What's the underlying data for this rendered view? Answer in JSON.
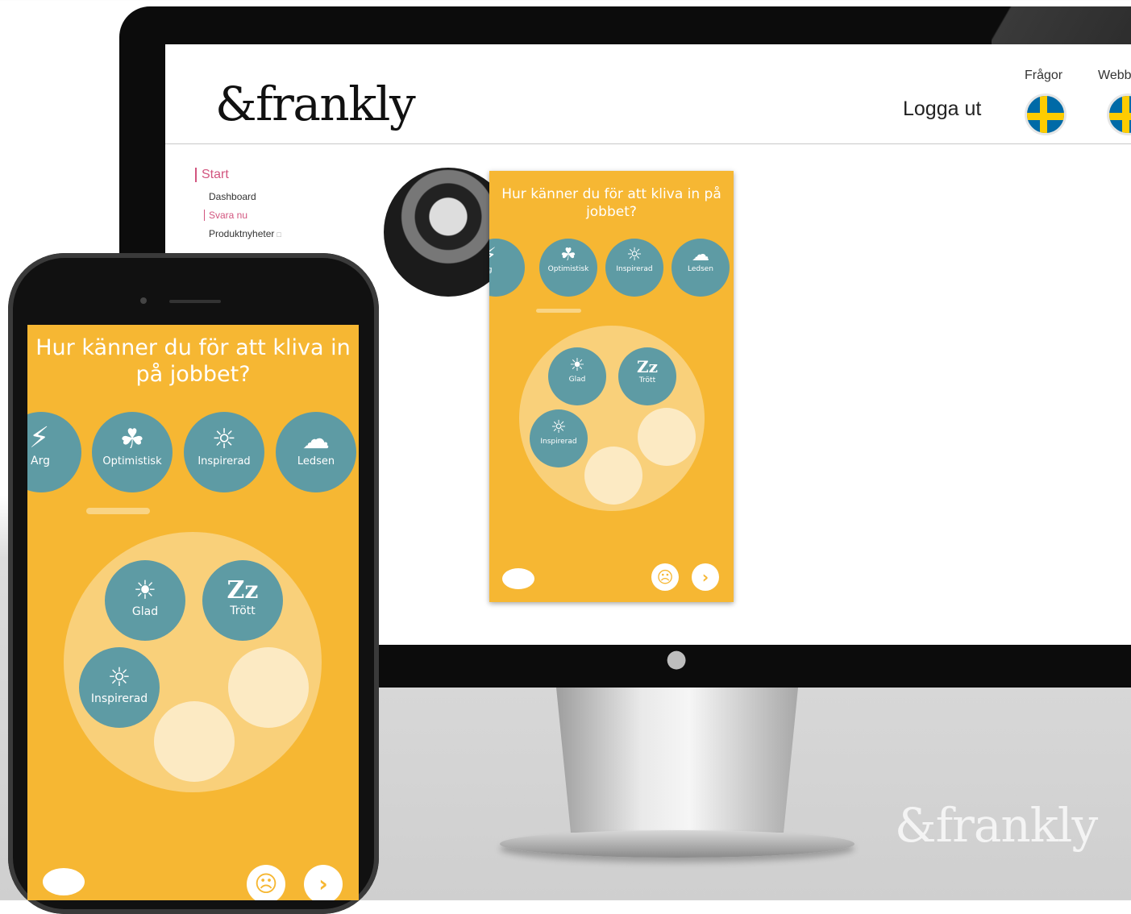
{
  "brand": {
    "logo": "&frankly",
    "watermark": "&frankly"
  },
  "header": {
    "logout": "Logga ut",
    "questions_label": "Frågor",
    "web_label": "Webb"
  },
  "sidebar": {
    "start": "Start",
    "items": [
      {
        "label": "Dashboard"
      },
      {
        "label": "Svara nu"
      },
      {
        "label": "Produktnyheter"
      }
    ]
  },
  "survey": {
    "question": "Hur känner du för att kliva in på jobbet?",
    "options": [
      {
        "label": "Arg",
        "icon": "lightning-icon"
      },
      {
        "label": "Optimistisk",
        "icon": "sprout-icon"
      },
      {
        "label": "Inspirerad",
        "icon": "lightbulb-icon"
      },
      {
        "label": "Ledsen",
        "icon": "rain-cloud-icon"
      }
    ],
    "selected": [
      {
        "label": "Glad",
        "icon": "sun-icon"
      },
      {
        "label": "Trött",
        "icon": "sleep-icon"
      },
      {
        "label": "Inspirerad",
        "icon": "lightbulb-icon"
      }
    ]
  },
  "colors": {
    "card": "#F6B733",
    "emotion": "#5E9BA4",
    "accent": "#d2557f"
  }
}
